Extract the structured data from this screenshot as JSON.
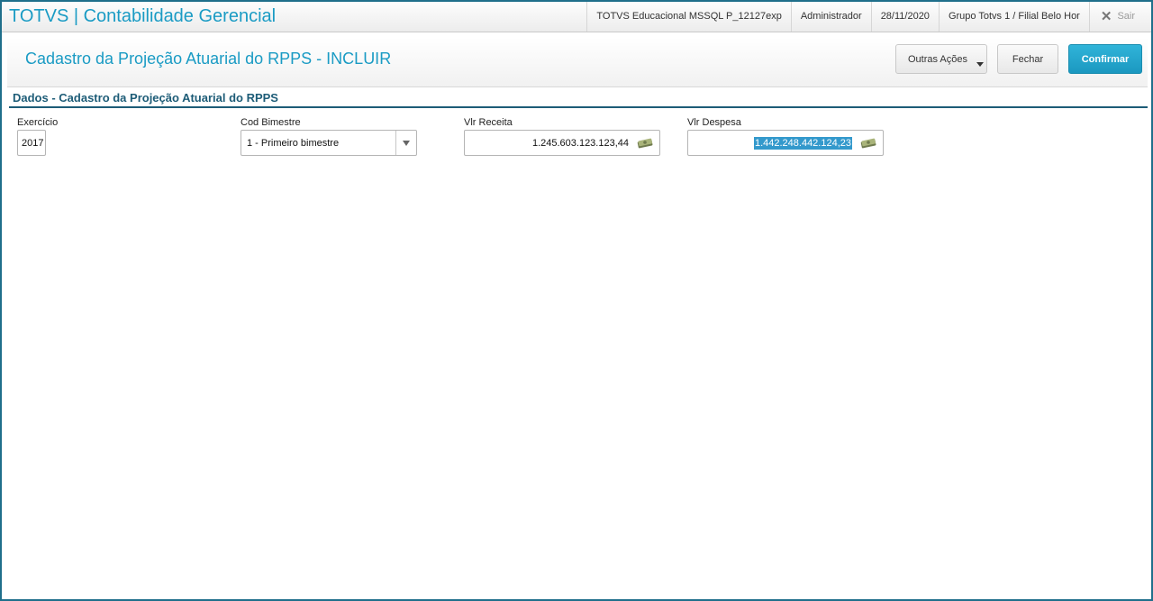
{
  "app": {
    "title": "TOTVS | Contabilidade Gerencial"
  },
  "topbar": {
    "environment": "TOTVS Educacional MSSQL P_12127exp",
    "user": "Administrador",
    "date": "28/11/2020",
    "company": "Grupo Totvs 1 / Filial Belo Hor",
    "exit_label": "Sair"
  },
  "header": {
    "page_title": "Cadastro da Projeção Atuarial do RPPS - INCLUIR",
    "buttons": {
      "other_actions": "Outras Ações",
      "close": "Fechar",
      "confirm": "Confirmar"
    }
  },
  "section": {
    "title": "Dados - Cadastro da Projeção Atuarial do RPPS"
  },
  "fields": {
    "exercicio": {
      "label": "Exercício",
      "value": "2017"
    },
    "cod_bimestre": {
      "label": "Cod Bimestre",
      "value": "1 - Primeiro bimestre"
    },
    "vlr_receita": {
      "label": "Vlr Receita",
      "value": "1.245.603.123.123,44"
    },
    "vlr_despesa": {
      "label": "Vlr Despesa",
      "value": "1.442.248.442.124,23"
    }
  },
  "icons": {
    "money": "money-icon",
    "close": "close-icon",
    "dropdown": "chevron-down-icon"
  },
  "colors": {
    "accent": "#1a9bc4",
    "section": "#1d5c77",
    "frame": "#1f6f8b",
    "selection": "#3399cc"
  }
}
